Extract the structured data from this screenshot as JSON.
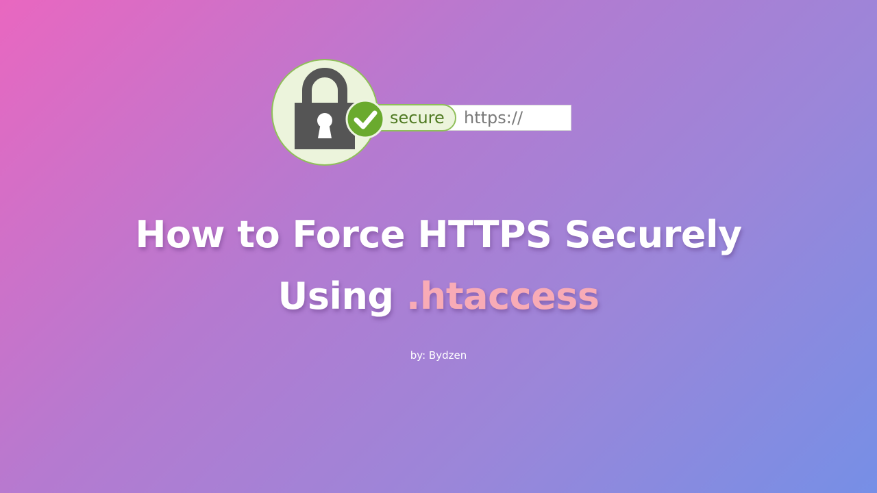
{
  "badge": {
    "secure_label": "secure",
    "url_prefix": "https://",
    "icons": [
      "lock-icon",
      "checkmark-icon"
    ]
  },
  "title": {
    "line1": "How to Force HTTPS Securely",
    "line2_prefix": "Using ",
    "line2_accent": ".htaccess"
  },
  "byline": "by: Bydzen",
  "colors": {
    "gradient_start": "#e967c0",
    "gradient_end": "#768fe6",
    "accent_text": "#f8abb6",
    "secure_green": "#6aaa2e",
    "lock_gray": "#555555"
  }
}
